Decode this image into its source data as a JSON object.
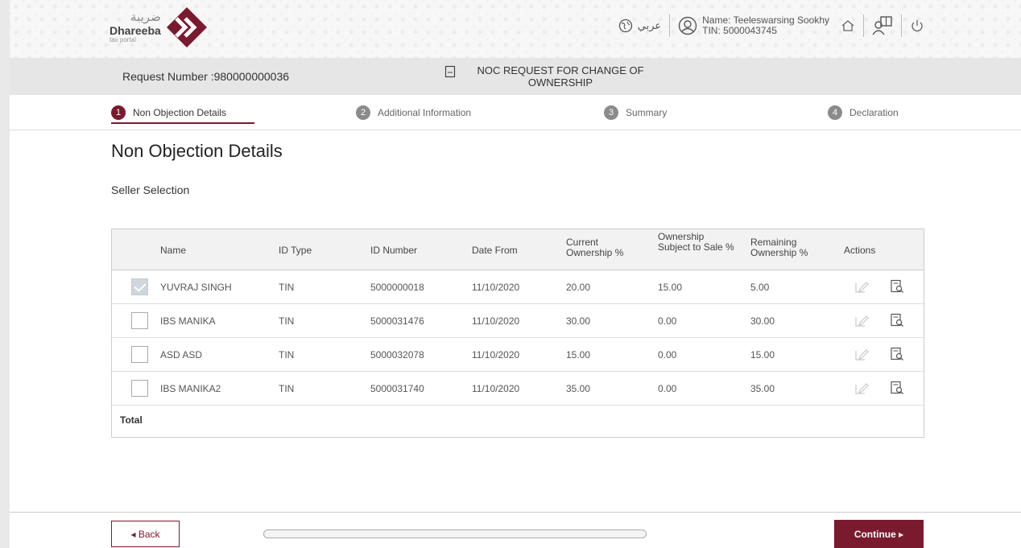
{
  "header": {
    "logo_ar": "ضريبة",
    "logo_en": "Dhareeba",
    "logo_sub": "tax portal",
    "language_label": "عربي",
    "user_name": "Name: Teeleswarsing Sookhy",
    "user_tin": "TIN: 5000043745",
    "icons": [
      "globe-icon",
      "user-icon",
      "home-icon",
      "org-switch-icon",
      "power-icon"
    ]
  },
  "request": {
    "number_label": "Request Number :980000000036",
    "title": "NOC REQUEST FOR CHANGE OF OWNERSHIP"
  },
  "steps": [
    {
      "num": "1",
      "label": "Non Objection Details",
      "active": true
    },
    {
      "num": "2",
      "label": "Additional Information",
      "active": false
    },
    {
      "num": "3",
      "label": "Summary",
      "active": false
    },
    {
      "num": "4",
      "label": "Declaration",
      "active": false
    }
  ],
  "main": {
    "title": "Non Objection Details",
    "section_label": "Seller Selection"
  },
  "table": {
    "headers": {
      "name": "Name",
      "id_type": "ID Type",
      "id_number": "ID Number",
      "date_from": "Date From",
      "current_ownership": "Current Ownership %",
      "subject_to_sale": "Ownership Subject to Sale %",
      "remaining_ownership": "Remaining Ownership %",
      "actions": "Actions"
    },
    "rows": [
      {
        "checked": true,
        "name": "YUVRAJ SINGH",
        "id_type": "TIN",
        "id_number": "5000000018",
        "date_from": "11/10/2020",
        "current": "20.00",
        "subject": "15.00",
        "remaining": "5.00"
      },
      {
        "checked": false,
        "name": "IBS MANIKA",
        "id_type": "TIN",
        "id_number": "5000031476",
        "date_from": "11/10/2020",
        "current": "30.00",
        "subject": "0.00",
        "remaining": "30.00"
      },
      {
        "checked": false,
        "name": "ASD ASD",
        "id_type": "TIN",
        "id_number": "5000032078",
        "date_from": "11/10/2020",
        "current": "15.00",
        "subject": "0.00",
        "remaining": "15.00"
      },
      {
        "checked": false,
        "name": "IBS MANIKA2",
        "id_type": "TIN",
        "id_number": "5000031740",
        "date_from": "11/10/2020",
        "current": "35.00",
        "subject": "0.00",
        "remaining": "35.00"
      }
    ],
    "total_label": "Total"
  },
  "footer": {
    "back_label": "◂ Back",
    "continue_label": "Continue ▸"
  },
  "colors": {
    "brand": "#7a1a2e",
    "step_inactive": "#8b8b8b"
  }
}
